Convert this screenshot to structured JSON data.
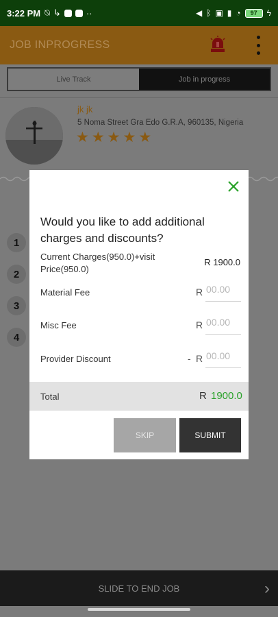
{
  "status": {
    "time": "3:22 PM",
    "battery": "97"
  },
  "appbar": {
    "title": "JOB INPROGRESS"
  },
  "tabs": [
    {
      "label": "Live Track"
    },
    {
      "label": "Job in progress"
    }
  ],
  "provider": {
    "name": "jk jk",
    "address": "5 Noma Street Gra Edo G.R.A, 960135, Nigeria",
    "rating": 5
  },
  "steps": [
    "1",
    "2",
    "3",
    "4"
  ],
  "dialog": {
    "question": "Would you like to add additional charges and discounts?",
    "current_charges_label": "Current Charges(950.0)+visit Price(950.0)",
    "current_charges_value": "R 1900.0",
    "material_fee_label": "Material Fee",
    "misc_fee_label": "Misc Fee",
    "provider_discount_label": "Provider Discount",
    "currency": "R",
    "discount_prefix": "-",
    "field_placeholder": "00.00",
    "total_label": "Total",
    "total_value": "1900.0",
    "skip_label": "SKIP",
    "submit_label": "SUBMIT"
  },
  "slider": {
    "label": "SLIDE TO END JOB"
  },
  "colors": {
    "accent": "#8a5a12",
    "total_green": "#27a127",
    "status_bar": "#0d3f0a"
  }
}
